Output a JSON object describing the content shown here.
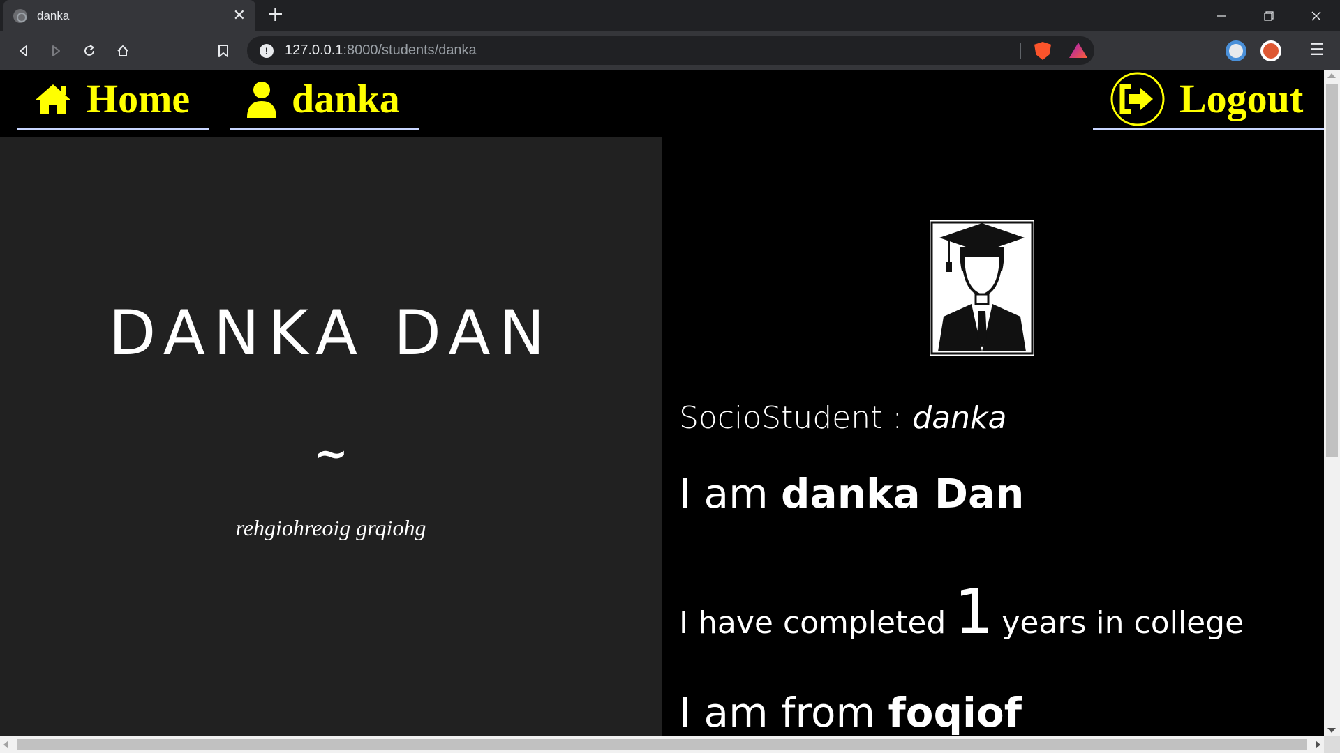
{
  "browser": {
    "tab_title": "danka",
    "tab_close": "✕",
    "new_tab": "+",
    "url_host": "127.0.0.1",
    "url_path": ":8000/students/danka",
    "info_icon": "!"
  },
  "navbar": {
    "home_label": "Home",
    "user_label": "danka",
    "logout_label": "Logout",
    "accent_color": "#ffff00",
    "underline_color": "#c9d6ff"
  },
  "profile": {
    "full_name": "DANKA DAN",
    "separator": "~",
    "bio": "rehgiohreoig grqiohg"
  },
  "details": {
    "socio_prefix": "SocioStudent : ",
    "socio_username": "danka",
    "intro_prefix": "I am ",
    "intro_name": "danka Dan",
    "years_prefix": "I have completed",
    "years_value": "1",
    "years_suffix": "years in college",
    "from_prefix": "I am from ",
    "from_place": "foqiof"
  },
  "colors": {
    "left_panel_bg": "#212121",
    "right_panel_bg": "#000000"
  }
}
